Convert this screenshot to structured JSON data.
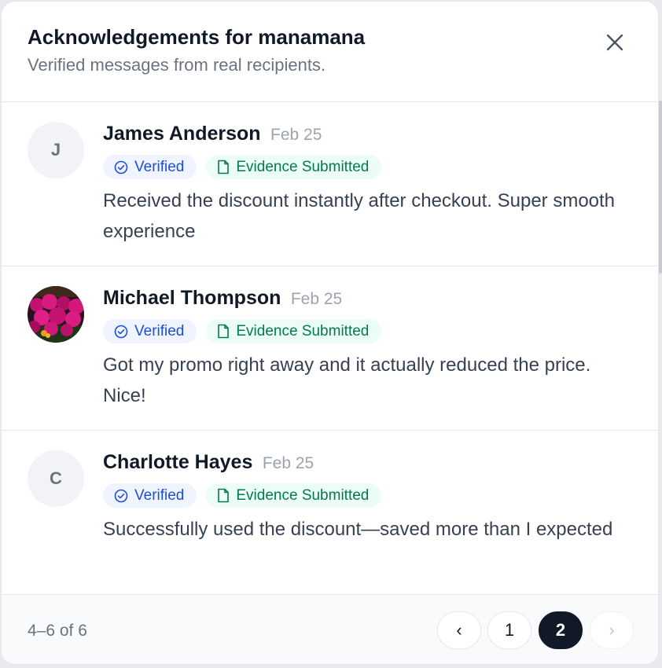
{
  "dialog": {
    "title": "Acknowledgements for manamana",
    "subtitle": "Verified messages from real recipients.",
    "close_icon": "close-icon"
  },
  "reviews": [
    {
      "initial": "J",
      "name": "James Anderson",
      "date": "Feb 25",
      "verified_label": "Verified",
      "evidence_label": "Evidence Submitted",
      "message": "Received the discount instantly after checkout. Super smooth experience"
    },
    {
      "initial": "",
      "name": "Michael Thompson",
      "date": "Feb 25",
      "verified_label": "Verified",
      "evidence_label": "Evidence Submitted",
      "message": "Got my promo right away and it actually reduced the price. Nice!"
    },
    {
      "initial": "C",
      "name": "Charlotte Hayes",
      "date": "Feb 25",
      "verified_label": "Verified",
      "evidence_label": "Evidence Submitted",
      "message": "Successfully used the discount—saved more than I expected"
    }
  ],
  "footer": {
    "range": "4–6 of 6",
    "prev_label": "‹",
    "next_label": "›",
    "pages": [
      "1",
      "2"
    ],
    "current_page": "2"
  },
  "colors": {
    "verified_text": "#1d4ed8",
    "verified_bg": "#eff4ff",
    "evidence_text": "#047857",
    "evidence_bg": "#ecfdf5",
    "active_page_bg": "#111827"
  }
}
